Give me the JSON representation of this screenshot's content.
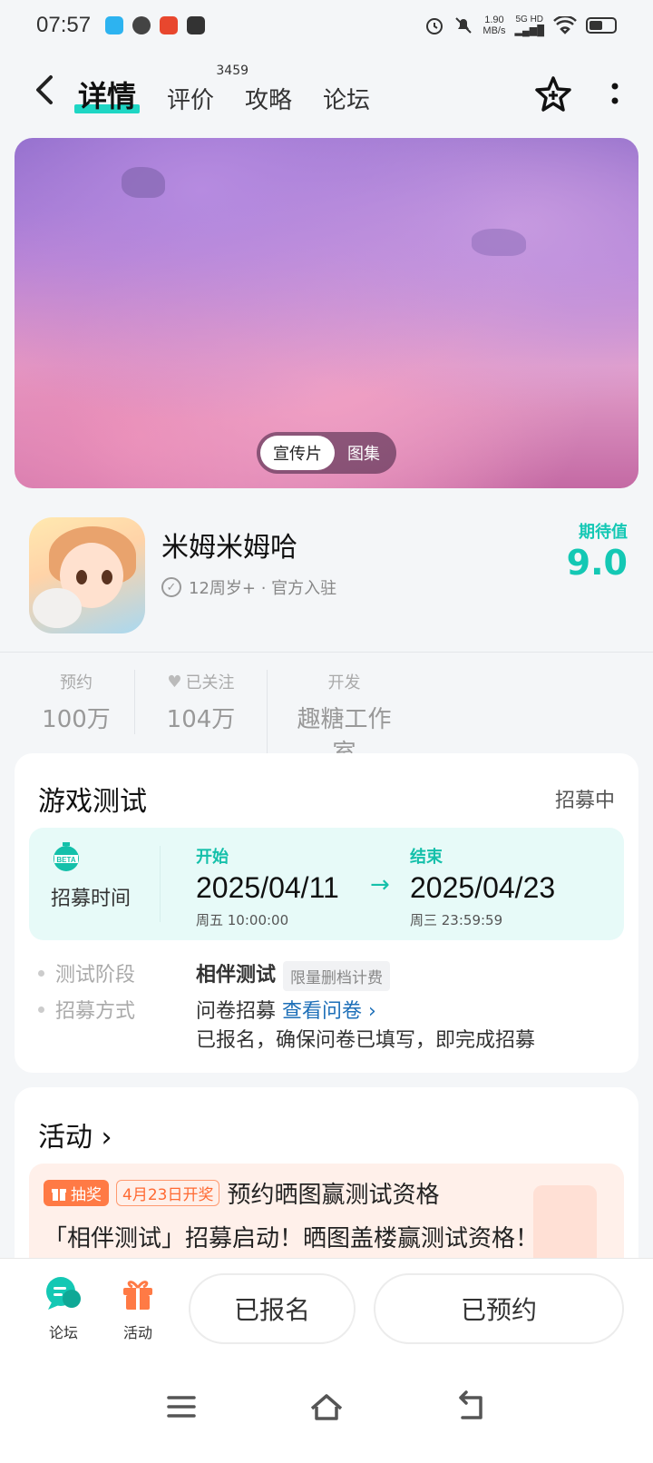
{
  "status_bar": {
    "time": "07:57",
    "speed": "1.90",
    "speed_unit": "MB/s",
    "network": "5G HD"
  },
  "nav": {
    "tabs": [
      {
        "label": "详情",
        "active": true
      },
      {
        "label": "评价",
        "badge": "3459"
      },
      {
        "label": "攻略"
      },
      {
        "label": "论坛"
      }
    ]
  },
  "banner": {
    "toggle": [
      "宣传片",
      "图集"
    ]
  },
  "game": {
    "title": "米姆米姆哈",
    "meta": "12周岁+ · 官方入驻",
    "expect_label": "期待值",
    "expect_value": "9.0"
  },
  "stats": [
    {
      "label": "预约",
      "value": "100万"
    },
    {
      "label": "已关注",
      "value": "104万"
    },
    {
      "label": "开发",
      "value": "趣糖工作室"
    }
  ],
  "test_card": {
    "title": "游戏测试",
    "status": "招募中",
    "recruit_label": "招募时间",
    "start_label": "开始",
    "start_date": "2025/04/11",
    "start_time": "周五  10:00:00",
    "end_label": "结束",
    "end_date": "2025/04/23",
    "end_time": "周三  23:59:59",
    "stage_key": "测试阶段",
    "stage_value": "相伴测试",
    "stage_tag": "限量删档计费",
    "method_key": "招募方式",
    "method_value": "问卷招募",
    "method_link": "查看问卷 ›",
    "method_note": "已报名，确保问卷已填写，即完成招募"
  },
  "activity_card": {
    "title": "活动 ›",
    "lottery_tag": "抽奖",
    "date_tag": "4月23日开奖",
    "headline": "预约晒图赢测试资格",
    "subline": "「相伴测试」招募启动！晒图盖楼赢测试资格！"
  },
  "action_bar": {
    "forum_label": "论坛",
    "activity_label": "活动",
    "signed_up": "已报名",
    "reserved": "已预约"
  },
  "colors": {
    "accent": "#14c8b4",
    "orange": "#ff7a45",
    "link": "#1d6fb8"
  }
}
